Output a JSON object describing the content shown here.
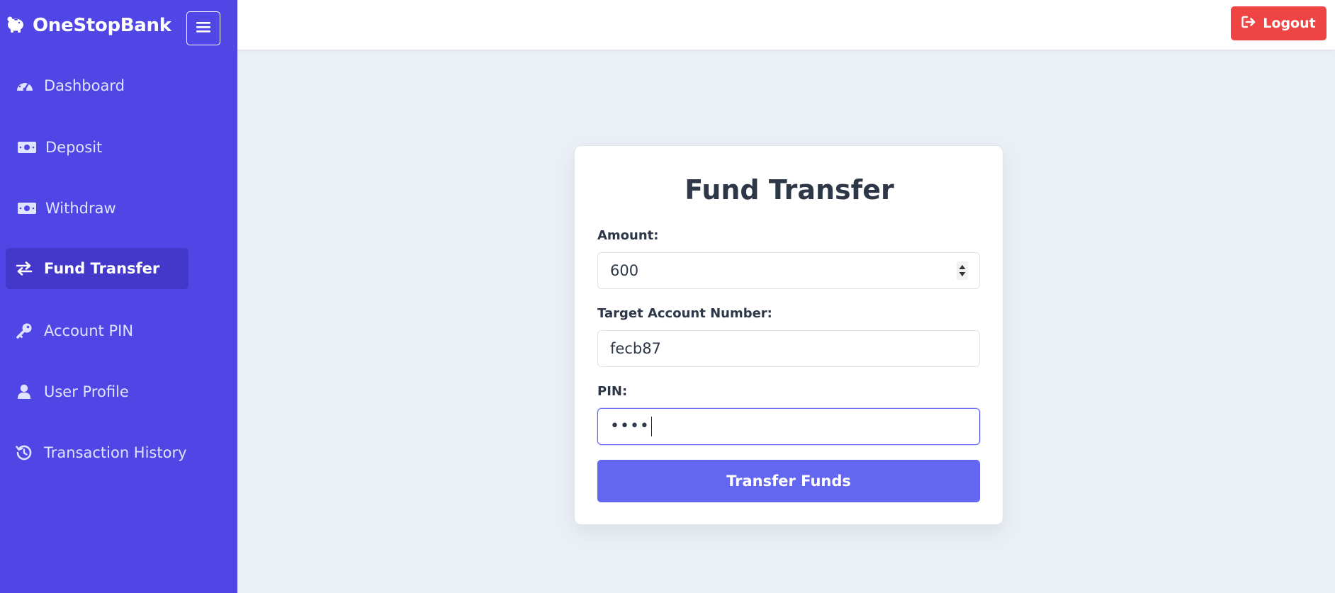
{
  "app": {
    "brand_name": "OneStopBank",
    "brand_icon": "piggy-bank-icon"
  },
  "sidebar": {
    "items": [
      {
        "label": "Dashboard",
        "icon": "gauge-icon",
        "active": false
      },
      {
        "label": "Deposit",
        "icon": "money-bill-icon",
        "active": false
      },
      {
        "label": "Withdraw",
        "icon": "money-bill-icon",
        "active": false
      },
      {
        "label": "Fund Transfer",
        "icon": "exchange-arrows-icon",
        "active": true
      },
      {
        "label": "Account PIN",
        "icon": "key-icon",
        "active": false
      },
      {
        "label": "User Profile",
        "icon": "user-icon",
        "active": false
      },
      {
        "label": "Transaction History",
        "icon": "history-icon",
        "active": false
      }
    ]
  },
  "header": {
    "logout_label": "Logout",
    "logout_icon": "sign-out-icon"
  },
  "form": {
    "title": "Fund Transfer",
    "amount_label": "Amount:",
    "amount_value": "600",
    "target_label": "Target Account Number:",
    "target_value": "fecb87",
    "pin_label": "PIN:",
    "pin_masked": "••••",
    "submit_label": "Transfer Funds"
  },
  "colors": {
    "sidebar_bg": "#4f46e5",
    "sidebar_active": "#4338ca",
    "accent": "#6366f1",
    "logout": "#ef4444",
    "page_bg": "#ebf0f7"
  }
}
